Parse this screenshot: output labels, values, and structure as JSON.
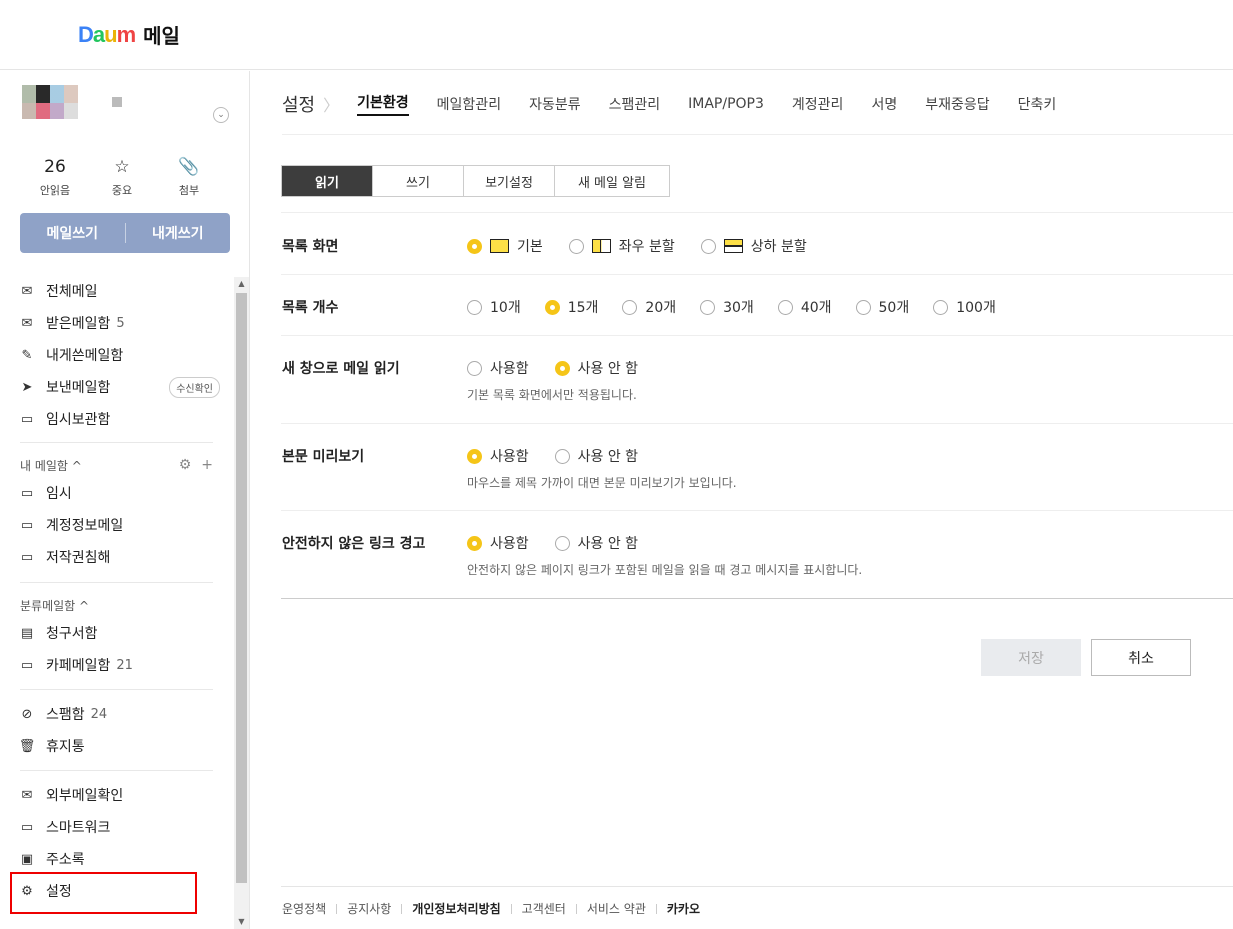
{
  "header": {
    "logo_text": "Daum",
    "app_name": "메일"
  },
  "sidebar": {
    "quick": [
      {
        "value": "26",
        "label": "안읽음"
      },
      {
        "value": "☆",
        "label": "중요"
      },
      {
        "value": "📎",
        "label": "첨부"
      }
    ],
    "write": {
      "compose": "메일쓰기",
      "self": "내게쓰기"
    },
    "folders_main": [
      {
        "label": "전체메일",
        "icon": "✉",
        "count": ""
      },
      {
        "label": "받은메일함",
        "icon": "✉",
        "count": "5"
      },
      {
        "label": "내게쓴메일함",
        "icon": "✎",
        "count": ""
      },
      {
        "label": "보낸메일함",
        "icon": "➤",
        "count": "",
        "badge": "수신확인"
      },
      {
        "label": "임시보관함",
        "icon": "▭",
        "count": ""
      }
    ],
    "my_section": {
      "title": "내 메일함 ^",
      "items": [
        "임시",
        "계정정보메일",
        "저작권침해"
      ]
    },
    "class_section": {
      "title": "분류메일함 ^",
      "items": [
        {
          "label": "청구서함",
          "count": ""
        },
        {
          "label": "카페메일함",
          "count": "21"
        }
      ]
    },
    "junk": [
      {
        "label": "스팸함",
        "icon": "⊘",
        "count": "24"
      },
      {
        "label": "휴지통",
        "icon": "🗑",
        "count": ""
      }
    ],
    "extras": [
      {
        "label": "외부메일확인",
        "icon": "✉"
      },
      {
        "label": "스마트워크",
        "icon": "▭"
      },
      {
        "label": "주소록",
        "icon": "▣"
      },
      {
        "label": "설정",
        "icon": "⚙"
      }
    ]
  },
  "main": {
    "crumb": "설정",
    "tabs": [
      "기본환경",
      "메일함관리",
      "자동분류",
      "스팸관리",
      "IMAP/POP3",
      "계정관리",
      "서명",
      "부재중응답",
      "단축키"
    ],
    "subtabs": [
      "읽기",
      "쓰기",
      "보기설정",
      "새 메일 알림"
    ],
    "rows": {
      "list_view": {
        "label": "목록 화면",
        "options": [
          "기본",
          "좌우 분할",
          "상하 분할"
        ],
        "selected": "기본"
      },
      "list_count": {
        "label": "목록 개수",
        "options": [
          "10개",
          "15개",
          "20개",
          "30개",
          "40개",
          "50개",
          "100개"
        ],
        "selected": "15개"
      },
      "new_window": {
        "label": "새 창으로 메일 읽기",
        "options": [
          "사용함",
          "사용 안 함"
        ],
        "selected": "사용 안 함",
        "desc": "기본 목록 화면에서만 적용됩니다."
      },
      "preview": {
        "label": "본문 미리보기",
        "options": [
          "사용함",
          "사용 안 함"
        ],
        "selected": "사용함",
        "desc": "마우스를 제목 가까이 대면 본문 미리보기가 보입니다."
      },
      "unsafe_link": {
        "label": "안전하지 않은 링크 경고",
        "options": [
          "사용함",
          "사용 안 함"
        ],
        "selected": "사용함",
        "desc": "안전하지 않은 페이지 링크가 포함된 메일을 읽을 때 경고 메시지를 표시합니다."
      }
    },
    "buttons": {
      "save": "저장",
      "cancel": "취소"
    },
    "footer": [
      "운영정책",
      "공지사항",
      "개인정보처리방침",
      "고객센터",
      "서비스 약관",
      "카카오"
    ]
  },
  "colors": {
    "accent_radio": "#f5c518",
    "write_button": "#8fa2c7",
    "highlight_box": "#e00000"
  }
}
